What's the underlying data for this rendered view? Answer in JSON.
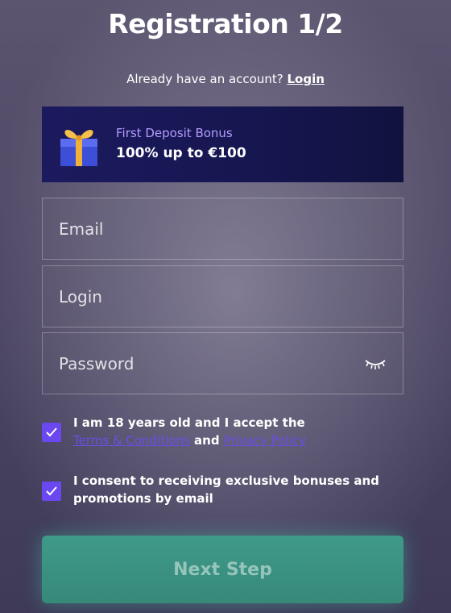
{
  "header": {
    "title": "Registration 1/2"
  },
  "account": {
    "prompt": "Already have an account?",
    "login_link": "Login"
  },
  "bonus": {
    "label": "First Deposit Bonus",
    "value": "100% up to €100",
    "icon": "gift-icon"
  },
  "form": {
    "email_placeholder": "Email",
    "login_placeholder": "Login",
    "password_placeholder": "Password",
    "password_toggle_icon": "eye-closed-icon"
  },
  "consents": {
    "age": {
      "checked": true,
      "text_prefix": "I am 18 years old and I accept the",
      "terms_link": "Terms & Conditions",
      "joiner": "and",
      "privacy_link": "Privacy Policy"
    },
    "marketing": {
      "checked": true,
      "text": "I consent to receiving exclusive bonuses and promotions by email"
    }
  },
  "actions": {
    "next_label": "Next Step"
  },
  "colors": {
    "accent_purple": "#6b47f0",
    "bonus_bg": "#1c1a5e",
    "button_teal": "#3f9a89"
  }
}
